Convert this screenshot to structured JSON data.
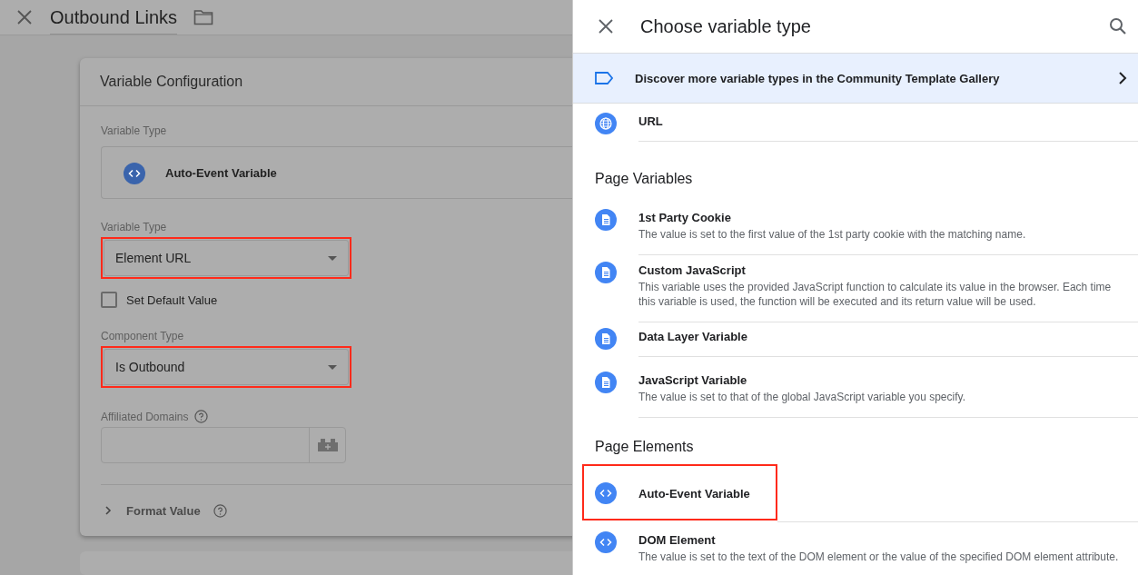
{
  "editor": {
    "title": "Outbound Links",
    "card": {
      "title": "Variable Configuration",
      "variable_type": {
        "label": "Variable Type",
        "value": "Auto-Event Variable"
      },
      "controls": [
        {
          "kind": "dropdown",
          "label": "Variable Type",
          "value": "Element URL",
          "highlighted": true
        },
        {
          "kind": "checkbox",
          "label": "Set Default Value",
          "checked": false
        },
        {
          "kind": "dropdown",
          "label": "Component Type",
          "value": "Is Outbound",
          "highlighted": true
        },
        {
          "kind": "input",
          "label": "Affiliated Domains"
        }
      ],
      "format_value": {
        "label": "Format Value",
        "expanded": false
      }
    }
  },
  "picker": {
    "title": "Choose variable type",
    "banner": "Discover more variable types in the Community Template Gallery",
    "sections": [
      {
        "items": [
          {
            "kind": "globe",
            "title": "URL",
            "highlighted": false
          }
        ]
      },
      {
        "heading": "Page Variables",
        "items": [
          {
            "kind": "doc",
            "title": "1st Party Cookie",
            "description": "The value is set to the first value of the 1st party cookie with the matching name.",
            "highlighted": false
          },
          {
            "kind": "doc",
            "title": "Custom JavaScript",
            "description": "This variable uses the provided JavaScript function to calculate its value in the browser. Each time this variable is used, the function will be executed and its return value will be used.",
            "highlighted": false
          },
          {
            "kind": "doc",
            "title": "Data Layer Variable",
            "highlighted": false
          },
          {
            "kind": "doc",
            "title": "JavaScript Variable",
            "description": "The value is set to that of the global JavaScript variable you specify.",
            "highlighted": false
          }
        ]
      },
      {
        "heading": "Page Elements",
        "items": [
          {
            "kind": "code",
            "title": "Auto-Event Variable",
            "highlighted": true
          },
          {
            "kind": "code",
            "title": "DOM Element",
            "description": "The value is set to the text of the DOM element or the value of the specified DOM element attribute.",
            "highlighted": false
          }
        ]
      }
    ]
  }
}
